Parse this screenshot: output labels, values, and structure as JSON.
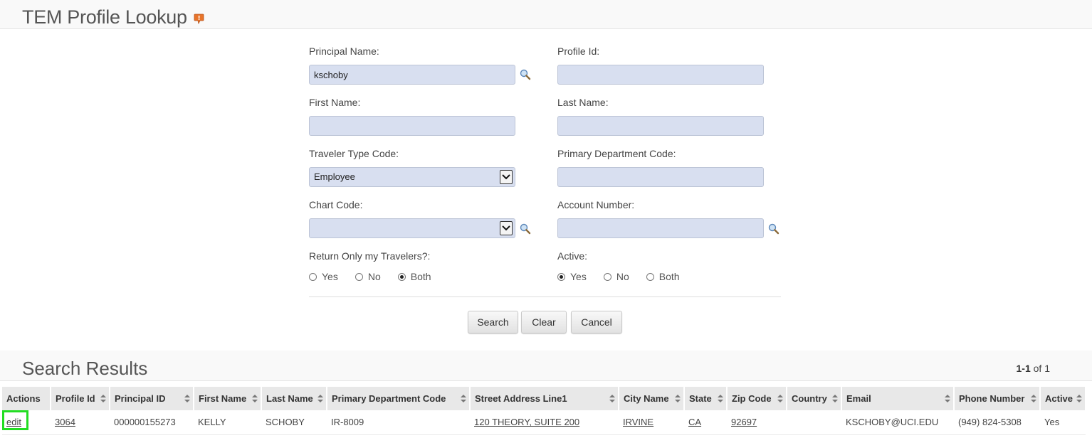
{
  "page": {
    "title": "TEM Profile Lookup"
  },
  "form": {
    "principal_name": {
      "label": "Principal Name:",
      "value": "kschoby"
    },
    "profile_id": {
      "label": "Profile Id:",
      "value": ""
    },
    "first_name": {
      "label": "First Name:",
      "value": ""
    },
    "last_name": {
      "label": "Last Name:",
      "value": ""
    },
    "traveler_type_code": {
      "label": "Traveler Type Code:",
      "value": "Employee"
    },
    "primary_department_code": {
      "label": "Primary Department Code:",
      "value": ""
    },
    "chart_code": {
      "label": "Chart Code:",
      "value": ""
    },
    "account_number": {
      "label": "Account Number:",
      "value": ""
    },
    "return_only_my_travelers": {
      "label": "Return Only my Travelers?:",
      "options": [
        "Yes",
        "No",
        "Both"
      ],
      "selected": "Both"
    },
    "active": {
      "label": "Active:",
      "options": [
        "Yes",
        "No",
        "Both"
      ],
      "selected": "Yes"
    }
  },
  "buttons": {
    "search": "Search",
    "clear": "Clear",
    "cancel": "Cancel"
  },
  "results": {
    "title": "Search Results",
    "count_range": "1-1",
    "count_of": "of 1",
    "columns": [
      "Actions",
      "Profile Id",
      "Principal ID",
      "First Name",
      "Last Name",
      "Primary Department Code",
      "Street Address Line1",
      "City Name",
      "State",
      "Zip Code",
      "Country",
      "Email",
      "Phone Number",
      "Active"
    ],
    "rows": [
      {
        "action": "edit",
        "profile_id": "3064",
        "principal_id": "000000155273",
        "first_name": "KELLY",
        "last_name": "SCHOBY",
        "primary_department_code": "IR-8009",
        "street_address": "120 THEORY, SUITE 200",
        "city_name": "IRVINE",
        "state": "CA",
        "zip_code": "92697",
        "country": "",
        "email": "KSCHOBY@UCI.EDU",
        "phone_number": "(949) 824-5308",
        "active": "Yes"
      }
    ]
  },
  "colors": {
    "input_bg": "#d8dff0",
    "highlight": "#22dd22",
    "help_icon": "#e8742a"
  }
}
